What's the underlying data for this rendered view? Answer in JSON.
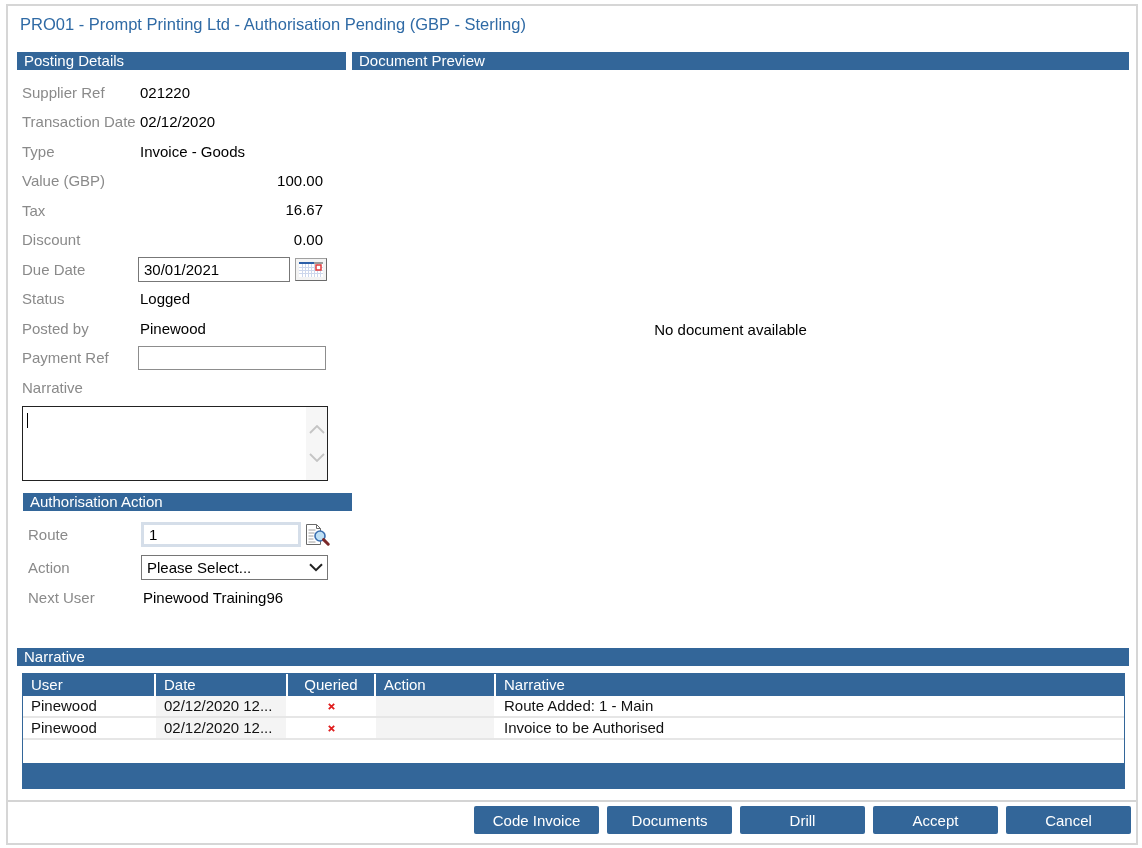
{
  "window": {
    "title": "PRO01 - Prompt Printing Ltd - Authorisation Pending (GBP - Sterling)"
  },
  "posting_details": {
    "heading": "Posting Details",
    "fields": [
      {
        "kind": "text",
        "label": "Supplier Ref",
        "value": "021220"
      },
      {
        "kind": "text",
        "label": "Transaction Date",
        "value": "02/12/2020"
      },
      {
        "kind": "text",
        "label": "Type",
        "value": "Invoice - Goods"
      },
      {
        "kind": "amount",
        "label": "Value (GBP)",
        "value": "100.00"
      },
      {
        "kind": "amount",
        "label": "Tax",
        "value": "16.67"
      },
      {
        "kind": "amount",
        "label": "Discount",
        "value": "0.00"
      },
      {
        "kind": "date",
        "label": "Due Date",
        "value": "30/01/2021"
      },
      {
        "kind": "text",
        "label": "Status",
        "value": "Logged"
      },
      {
        "kind": "text",
        "label": "Posted by",
        "value": "Pinewood"
      },
      {
        "kind": "input",
        "label": "Payment Ref"
      },
      {
        "kind": "textarea",
        "label": "Narrative",
        "focused": true
      }
    ]
  },
  "document_preview": {
    "heading": "Document Preview",
    "message": "No document available"
  },
  "authorisation_action": {
    "heading": "Authorisation Action",
    "fields": [
      {
        "kind": "lookup",
        "label": "Route",
        "value": "1"
      },
      {
        "kind": "select",
        "label": "Action",
        "value": "Please Select..."
      },
      {
        "kind": "text",
        "label": "Next User",
        "value": "Pinewood Training96"
      }
    ]
  },
  "narrative_log": {
    "heading": "Narrative",
    "columns": [
      "User",
      "Date",
      "Queried",
      "Action",
      "Narrative"
    ],
    "rows": [
      {
        "user": "Pinewood",
        "date": "02/12/2020 12...",
        "queried": false,
        "narrative": "Route Added: 1 - Main"
      },
      {
        "user": "Pinewood",
        "date": "02/12/2020 12...",
        "queried": false,
        "narrative": "Invoice to be Authorised"
      }
    ]
  },
  "buttons": [
    "Code Invoice",
    "Documents",
    "Drill",
    "Accept",
    "Cancel"
  ]
}
